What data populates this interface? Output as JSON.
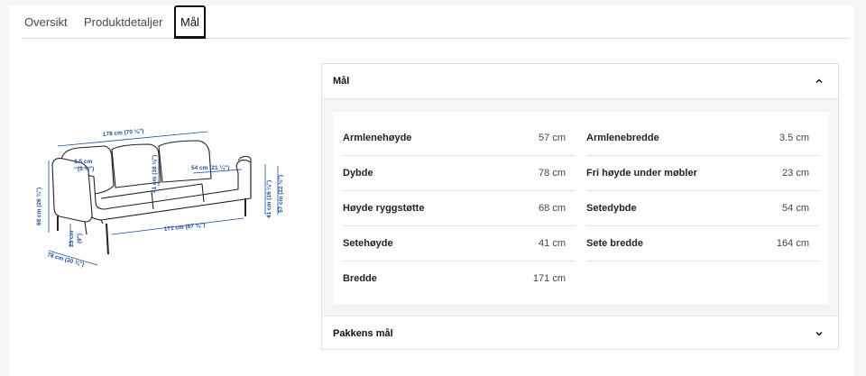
{
  "tabs": [
    {
      "label": "Oversikt"
    },
    {
      "label": "Produktdetaljer"
    },
    {
      "label": "Mål"
    }
  ],
  "drawing_labels": {
    "width_total": "178 cm (70 ⅛\")",
    "arm_width": "3.5 cm",
    "arm_width_in": "(1 ⅜\")",
    "seat_depth": "54 cm (21 ¼\")",
    "height_back": "68 cm (26 ¾\")",
    "seat_height": "41 cm (16 ⅛\")",
    "seat_height2": "41 cm (16 ⅛\")",
    "arm_height": "57 cm (22 ½\")",
    "seat_width": "171 cm (67 ⅜\")",
    "under_height": "23 cm",
    "under_height_in": "(9\")",
    "depth": "78 cm (30 ¾\")"
  },
  "dimensions": {
    "title": "Mål",
    "left": [
      {
        "label": "Armlenehøyde",
        "value": "57 cm"
      },
      {
        "label": "Dybde",
        "value": "78 cm"
      },
      {
        "label": "Høyde ryggstøtte",
        "value": "68 cm"
      },
      {
        "label": "Setehøyde",
        "value": "41 cm"
      },
      {
        "label": "Bredde",
        "value": "171 cm"
      }
    ],
    "right": [
      {
        "label": "Armlenebredde",
        "value": "3.5 cm"
      },
      {
        "label": "Fri høyde under møbler",
        "value": "23 cm"
      },
      {
        "label": "Setedybde",
        "value": "54 cm"
      },
      {
        "label": "Sete bredde",
        "value": "164 cm"
      }
    ]
  },
  "package": {
    "title": "Pakkens mål"
  },
  "icons": {
    "collapse": "chevron-up-icon",
    "expand": "chevron-down-icon"
  }
}
